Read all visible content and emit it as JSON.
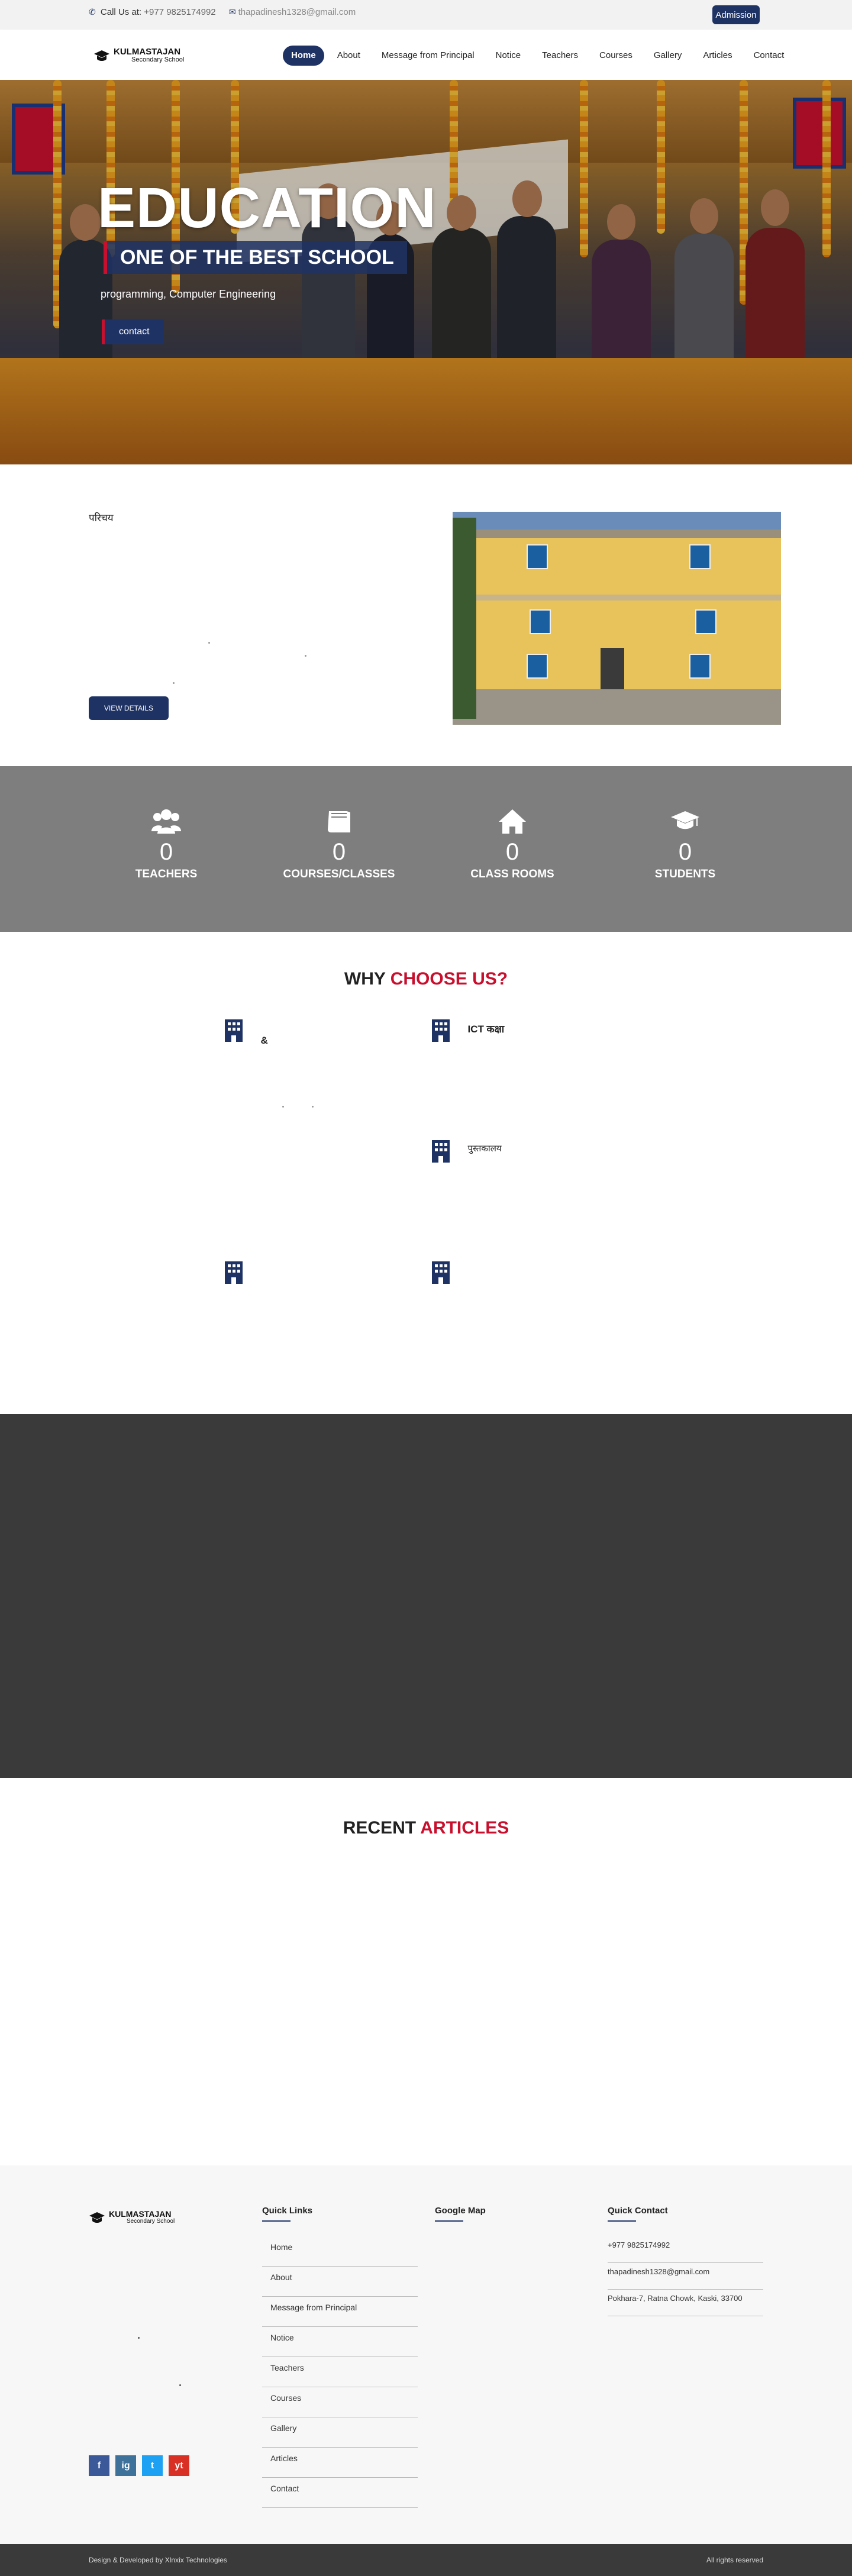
{
  "topbar": {
    "call_label": "Call Us at:",
    "phone": "+977 9825174992",
    "email": "thapadinesh1328@gmail.com",
    "admission_label": "Admission"
  },
  "brand": {
    "name": "KULMASTAJAN",
    "sub": "Secondary School"
  },
  "nav": [
    "Home",
    "About",
    "Message from Principal",
    "Notice",
    "Teachers",
    "Courses",
    "Gallery",
    "Articles",
    "Contact"
  ],
  "hero": {
    "headline": "EDUCATION",
    "tagline": "ONE OF THE BEST SCHOOL",
    "subtext": "programming, Computer Engineering",
    "button": "contact"
  },
  "about": {
    "title": "परिचय",
    "button": "VIEW DETAILS"
  },
  "stats": [
    {
      "icon": "users-icon",
      "num": "0",
      "label": "TEACHERS"
    },
    {
      "icon": "book-icon",
      "num": "0",
      "label": "COURSES/CLASSES"
    },
    {
      "icon": "home-icon",
      "num": "0",
      "label": "CLASS ROOMS"
    },
    {
      "icon": "graduation-cap-icon",
      "num": "0",
      "label": "STUDENTS"
    }
  ],
  "why": {
    "title_a": "WHY ",
    "title_b": "CHOOSE US?",
    "features": [
      {
        "title": "&"
      },
      {
        "title": "ICT कक्षा"
      },
      {
        "title": "पुस्तकालय"
      },
      {
        "title": ""
      },
      {
        "title": ""
      }
    ]
  },
  "articles": {
    "title_a": "RECENT ",
    "title_b": "ARTICLES"
  },
  "footer": {
    "quick_links_title": "Quick Links",
    "map_title": "Google Map",
    "contact_title": "Quick Contact",
    "links": [
      "Home",
      "About",
      "Message from Principal",
      "Notice",
      "Teachers",
      "Courses",
      "Gallery",
      "Articles",
      "Contact"
    ],
    "contact": [
      "+977 9825174992",
      "thapadinesh1328@gmail.com",
      "Pokhara-7, Ratna Chowk, Kaski, 33700"
    ],
    "social": [
      "f",
      "ig",
      "t",
      "yt"
    ]
  },
  "bottom": {
    "credit": "Design & Developed by Xlnxix Technologies",
    "rights": "All rights reserved"
  },
  "colors": {
    "primary": "#1e3264",
    "accent": "#c8102e",
    "stats_bg": "#7e7e7e",
    "video_bg": "#3a3a3a"
  }
}
